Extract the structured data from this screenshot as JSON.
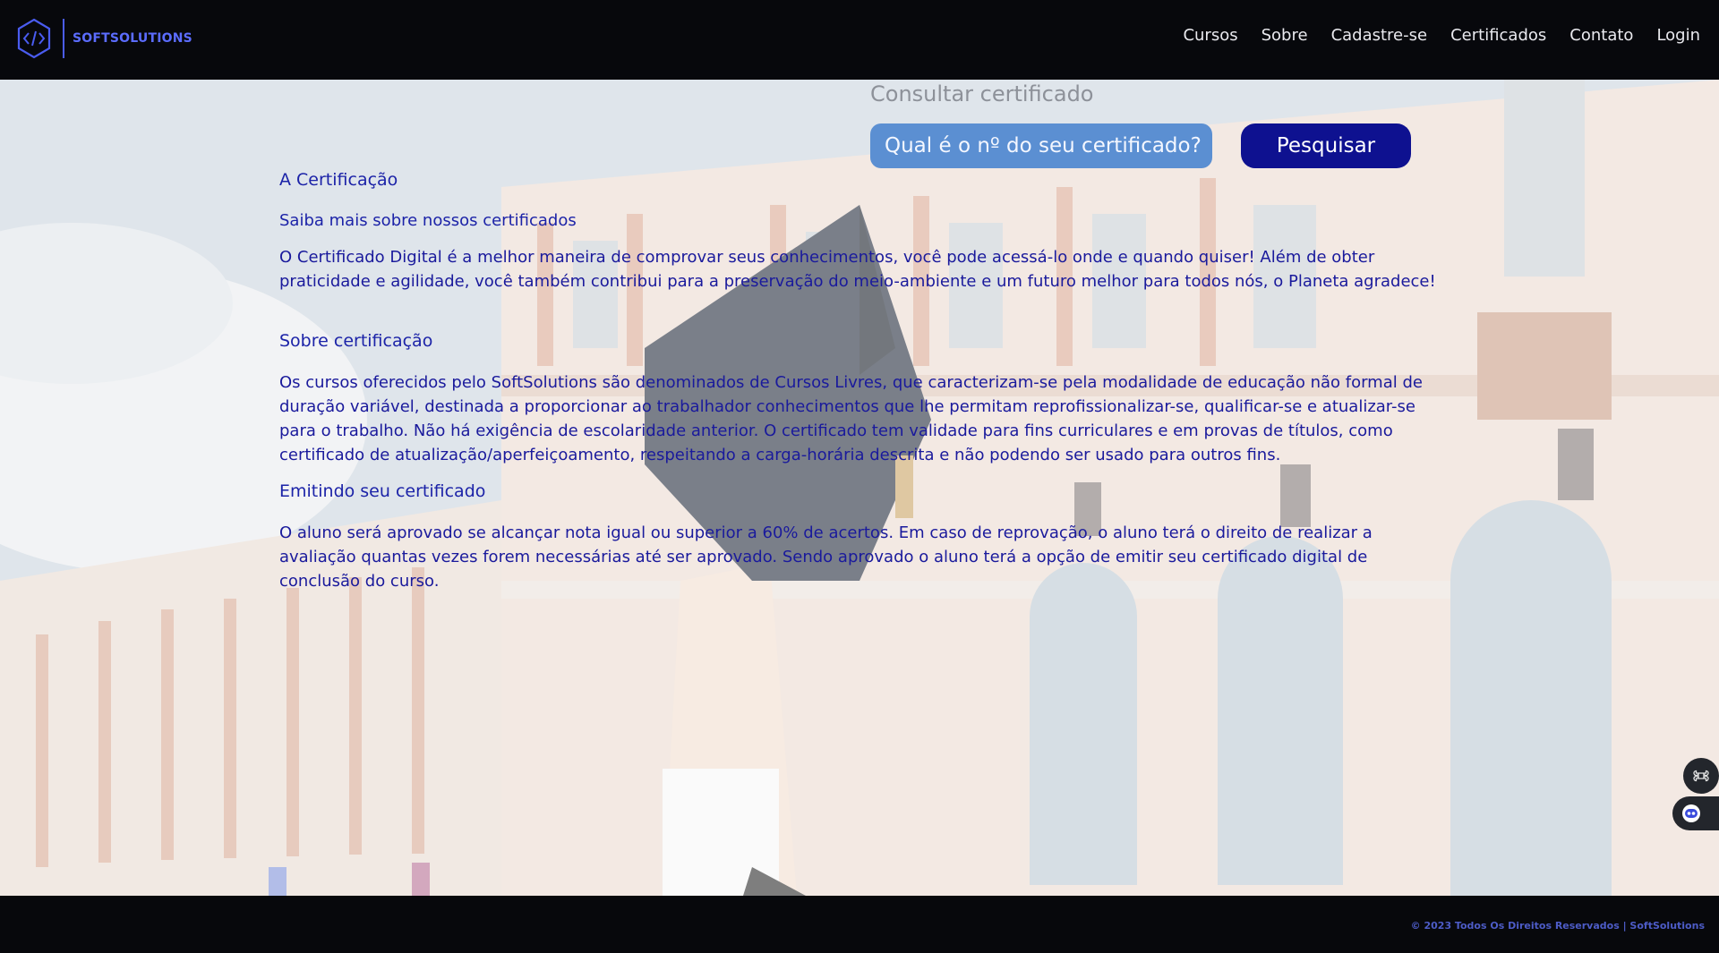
{
  "header": {
    "brand": "SOFTSOLUTIONS",
    "nav": [
      "Cursos",
      "Sobre",
      "Cadastre-se",
      "Certificados",
      "Contato",
      "Login"
    ]
  },
  "consult": {
    "title": "Consultar certificado",
    "input_placeholder": "Qual é o nº do seu certificado?",
    "button_label": "Pesquisar"
  },
  "content": {
    "heading1": "A Certificação",
    "heading2": "Saiba mais sobre nossos certificados",
    "para1": "O Certificado Digital é a melhor maneira de comprovar seus conhecimentos, você pode acessá-lo onde e quando quiser! Além de obter praticidade e agilidade, você também contribui para a preservação do meio-ambiente e um futuro melhor para todos nós, o Planeta agradece!",
    "heading3": "Sobre certificação",
    "para2": "Os cursos oferecidos pelo SoftSolutions são denominados de Cursos Livres, que caracterizam-se pela modalidade de educação não formal de duração variável, destinada a proporcionar ao trabalhador conhecimentos que lhe permitam reprofissionalizar-se, qualificar-se e atualizar-se para o trabalho. Não há exigência de escolaridade anterior. O certificado tem validade para fins curriculares e em provas de títulos, como certificado de atualização/aperfeiçoamento, respeitando a carga-horária descrita e não podendo ser usado para outros fins.",
    "heading4": "Emitindo seu certificado",
    "para3": "O aluno será aprovado se alcançar nota igual ou superior a 60% de acertos. Em caso de reprovação, o aluno terá o direito de realizar a avaliação quantas vezes forem necessárias até ser aprovado. Sendo aprovado o aluno terá a opção de emitir seu certificado digital de conclusão do curso."
  },
  "footer": {
    "text": "© 2023 Todos Os Direitos Reservados | SoftSolutions"
  },
  "colors": {
    "header_bg": "#07080c",
    "brand": "#5b6cff",
    "text_blue": "#1a1a9c",
    "input_bg": "#5b8fd2",
    "button_bg": "#0e1190"
  }
}
